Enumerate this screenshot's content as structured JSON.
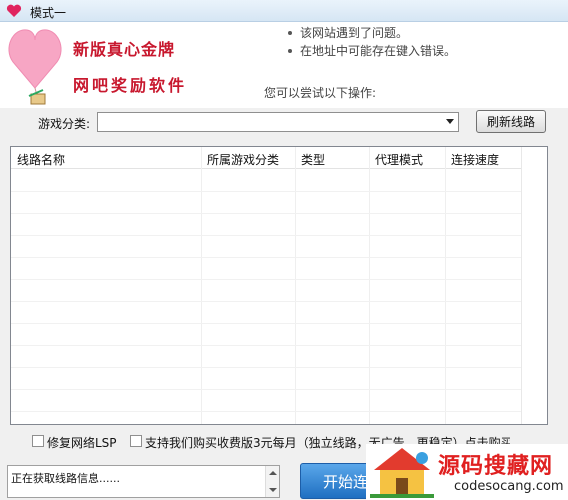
{
  "window": {
    "title": "模式一"
  },
  "banner": {
    "slogan_line1": "新版真心金牌",
    "slogan_line2": "网吧奖励软件",
    "error_items": [
      "该网站遇到了问题。",
      "在地址中可能存在键入错误。"
    ],
    "try_text": "您可以尝试以下操作:"
  },
  "toolbar": {
    "category_label": "游戏分类:",
    "category_value": "",
    "refresh_label": "刷新线路"
  },
  "table": {
    "columns": [
      "线路名称",
      "所属游戏分类",
      "类型",
      "代理模式",
      "连接速度"
    ],
    "rows": []
  },
  "options": {
    "repair_lsp_label": "修复网络LSP",
    "support_label": "支持我们购买收费版3元每月（独立线路，无广告，更稳定）点击购买"
  },
  "status": {
    "text": "正在获取线路信息......"
  },
  "actions": {
    "start_label": "开始连"
  },
  "watermark": {
    "title": "源码搜藏网",
    "domain": "codesocang.com"
  },
  "colors": {
    "accent": "#1f6fc1",
    "brand_red": "#c8182e",
    "heart_pink": "#f7a6c4"
  },
  "icons": {
    "title_icon": "heart-icon",
    "dropdown": "chevron-down-icon"
  }
}
